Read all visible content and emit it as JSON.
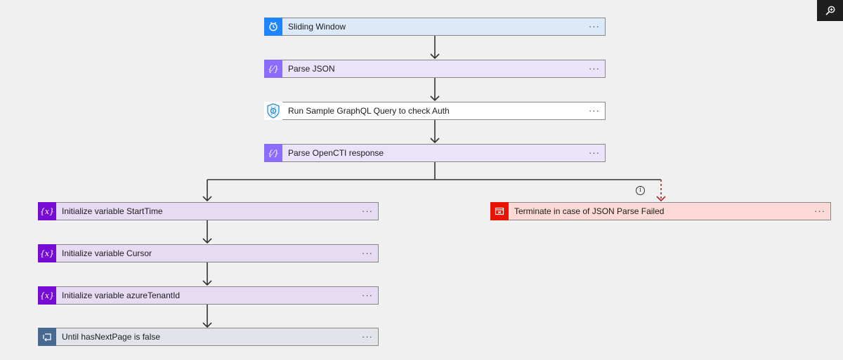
{
  "toolbar": {
    "zoom_icon": "zoom-in-icon"
  },
  "colors": {
    "trigger_bg": "#dce9f9",
    "trigger_icon": "#1f85ff",
    "parse_bg": "#ebe3f9",
    "parse_icon": "#8c6cff",
    "http_bg": "#ffffff",
    "var_bg": "#e6dbf2",
    "var_icon": "#770bd6",
    "terminate_bg": "#fcd9d6",
    "terminate_icon": "#e81300",
    "until_bg": "#e1e5ea",
    "until_icon": "#486991",
    "failed_connector": "#a4262c"
  },
  "steps": {
    "sliding_window": {
      "title": "Sliding Window",
      "icon": "clock-icon",
      "icon_text": "⏱",
      "more": "···"
    },
    "parse_json": {
      "title": "Parse JSON",
      "icon": "parse-json-icon",
      "icon_text": "{⁄}",
      "more": "···"
    },
    "run_graphql": {
      "title": "Run Sample GraphQL Query to check Auth",
      "icon": "graphql-shield-icon",
      "more": "···"
    },
    "parse_opencti": {
      "title": "Parse OpenCTI response",
      "icon": "parse-json-icon",
      "icon_text": "{⁄}",
      "more": "···"
    },
    "init_starttime": {
      "title": "Initialize variable StartTime",
      "icon": "variable-icon",
      "icon_text": "{x}",
      "more": "···"
    },
    "init_cursor": {
      "title": "Initialize variable Cursor",
      "icon": "variable-icon",
      "icon_text": "{x}",
      "more": "···"
    },
    "init_tenant": {
      "title": "Initialize variable azureTenantId",
      "icon": "variable-icon",
      "icon_text": "{x}",
      "more": "···"
    },
    "until_loop": {
      "title": "Until hasNextPage is false",
      "icon": "loop-icon",
      "more": "···"
    },
    "terminate": {
      "title": "Terminate in case of JSON Parse Failed",
      "icon": "terminate-icon",
      "more": "···"
    }
  },
  "branch_info": {
    "icon": "info-icon",
    "text": "i"
  }
}
